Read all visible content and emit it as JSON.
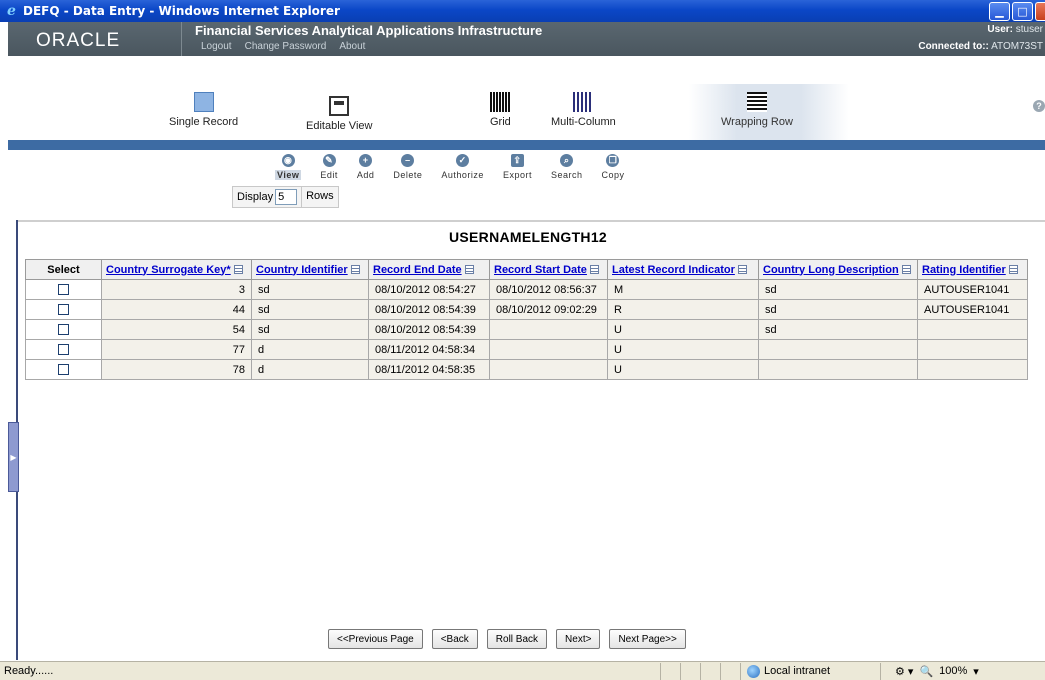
{
  "window": {
    "title": "DEFQ - Data Entry - Windows Internet Explorer",
    "controls": [
      "_",
      "□",
      "x"
    ]
  },
  "header": {
    "logo": "ORACLE",
    "app_title": "Financial Services Analytical Applications Infrastructure",
    "links": [
      "Logout",
      "Change Password",
      "About"
    ],
    "user_label": "User:",
    "user_value": "stuser",
    "connected_label": "Connected to::",
    "connected_value": "ATOM73ST"
  },
  "view_modes": [
    {
      "label": "Single Record",
      "icon": "single-record-icon"
    },
    {
      "label": "Editable View",
      "icon": "editable-view-icon"
    },
    {
      "label": "Grid",
      "icon": "grid-icon"
    },
    {
      "label": "Multi-Column",
      "icon": "multi-column-icon"
    },
    {
      "label": "Wrapping Row",
      "icon": "wrapping-row-icon",
      "selected": true
    }
  ],
  "toolbar": {
    "view": "View",
    "edit": "Edit",
    "add": "Add",
    "delete": "Delete",
    "authorize": "Authorize",
    "export": "Export",
    "search": "Search",
    "copy": "Copy"
  },
  "display": {
    "label": "Display",
    "value": "5",
    "rows_label": "Rows"
  },
  "table": {
    "title": "USERNAMELENGTH12",
    "select_header": "Select",
    "columns": [
      "Country Surrogate Key*",
      "Country Identifier",
      "Record End Date",
      "Record Start Date",
      "Latest Record Indicator",
      "Country Long Description",
      "Rating Identifier"
    ],
    "rows": [
      [
        "3",
        "sd",
        "08/10/2012 08:54:27",
        "08/10/2012 08:56:37",
        "M",
        "sd",
        "AUTOUSER1041"
      ],
      [
        "44",
        "sd",
        "08/10/2012 08:54:39",
        "08/10/2012 09:02:29",
        "R",
        "sd",
        "AUTOUSER1041"
      ],
      [
        "54",
        "sd",
        "08/10/2012 08:54:39",
        "",
        "U",
        "sd",
        ""
      ],
      [
        "77",
        "d",
        "08/11/2012 04:58:34",
        "",
        "U",
        "",
        ""
      ],
      [
        "78",
        "d",
        "08/11/2012 04:58:35",
        "",
        "U",
        "",
        ""
      ]
    ]
  },
  "pager": {
    "prev_page": "<<Previous Page",
    "back": "<Back",
    "rollback": "Roll Back",
    "next": "Next>",
    "next_page": "Next Page>>"
  },
  "statusbar": {
    "text": "Ready......",
    "zone": "Local intranet",
    "zoom": "100%"
  }
}
